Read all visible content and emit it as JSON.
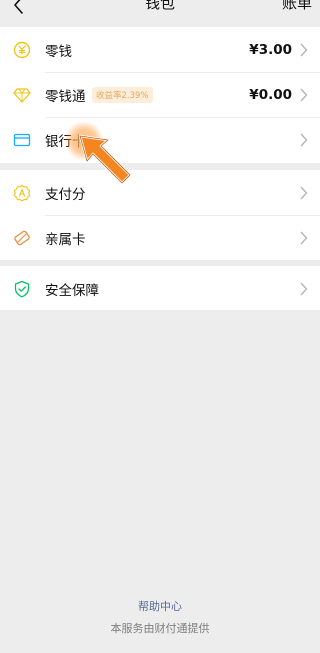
{
  "header": {
    "title": "钱包",
    "right_label": "账单",
    "back_icon": "chevron-left-icon"
  },
  "wallet": {
    "items": [
      {
        "label": "零钱",
        "value": "¥3.00",
        "icon": "yuan-coin-icon"
      },
      {
        "label": "零钱通",
        "badge": "收益率2.39%",
        "value": "¥0.00",
        "icon": "diamond-icon"
      },
      {
        "label": "银行卡",
        "icon": "bank-card-icon"
      }
    ]
  },
  "services": {
    "items": [
      {
        "label": "支付分",
        "icon": "score-badge-icon"
      },
      {
        "label": "亲属卡",
        "icon": "family-card-icon"
      }
    ]
  },
  "security": {
    "items": [
      {
        "label": "安全保障",
        "icon": "shield-icon"
      }
    ]
  },
  "footer": {
    "help_link": "帮助中心",
    "provider_note": "本服务由财付通提供"
  },
  "colors": {
    "accent_yellow": "#f0c419",
    "accent_blue": "#10aeff",
    "accent_green": "#07c160",
    "accent_orange": "#f08a3b",
    "link": "#576b95"
  }
}
